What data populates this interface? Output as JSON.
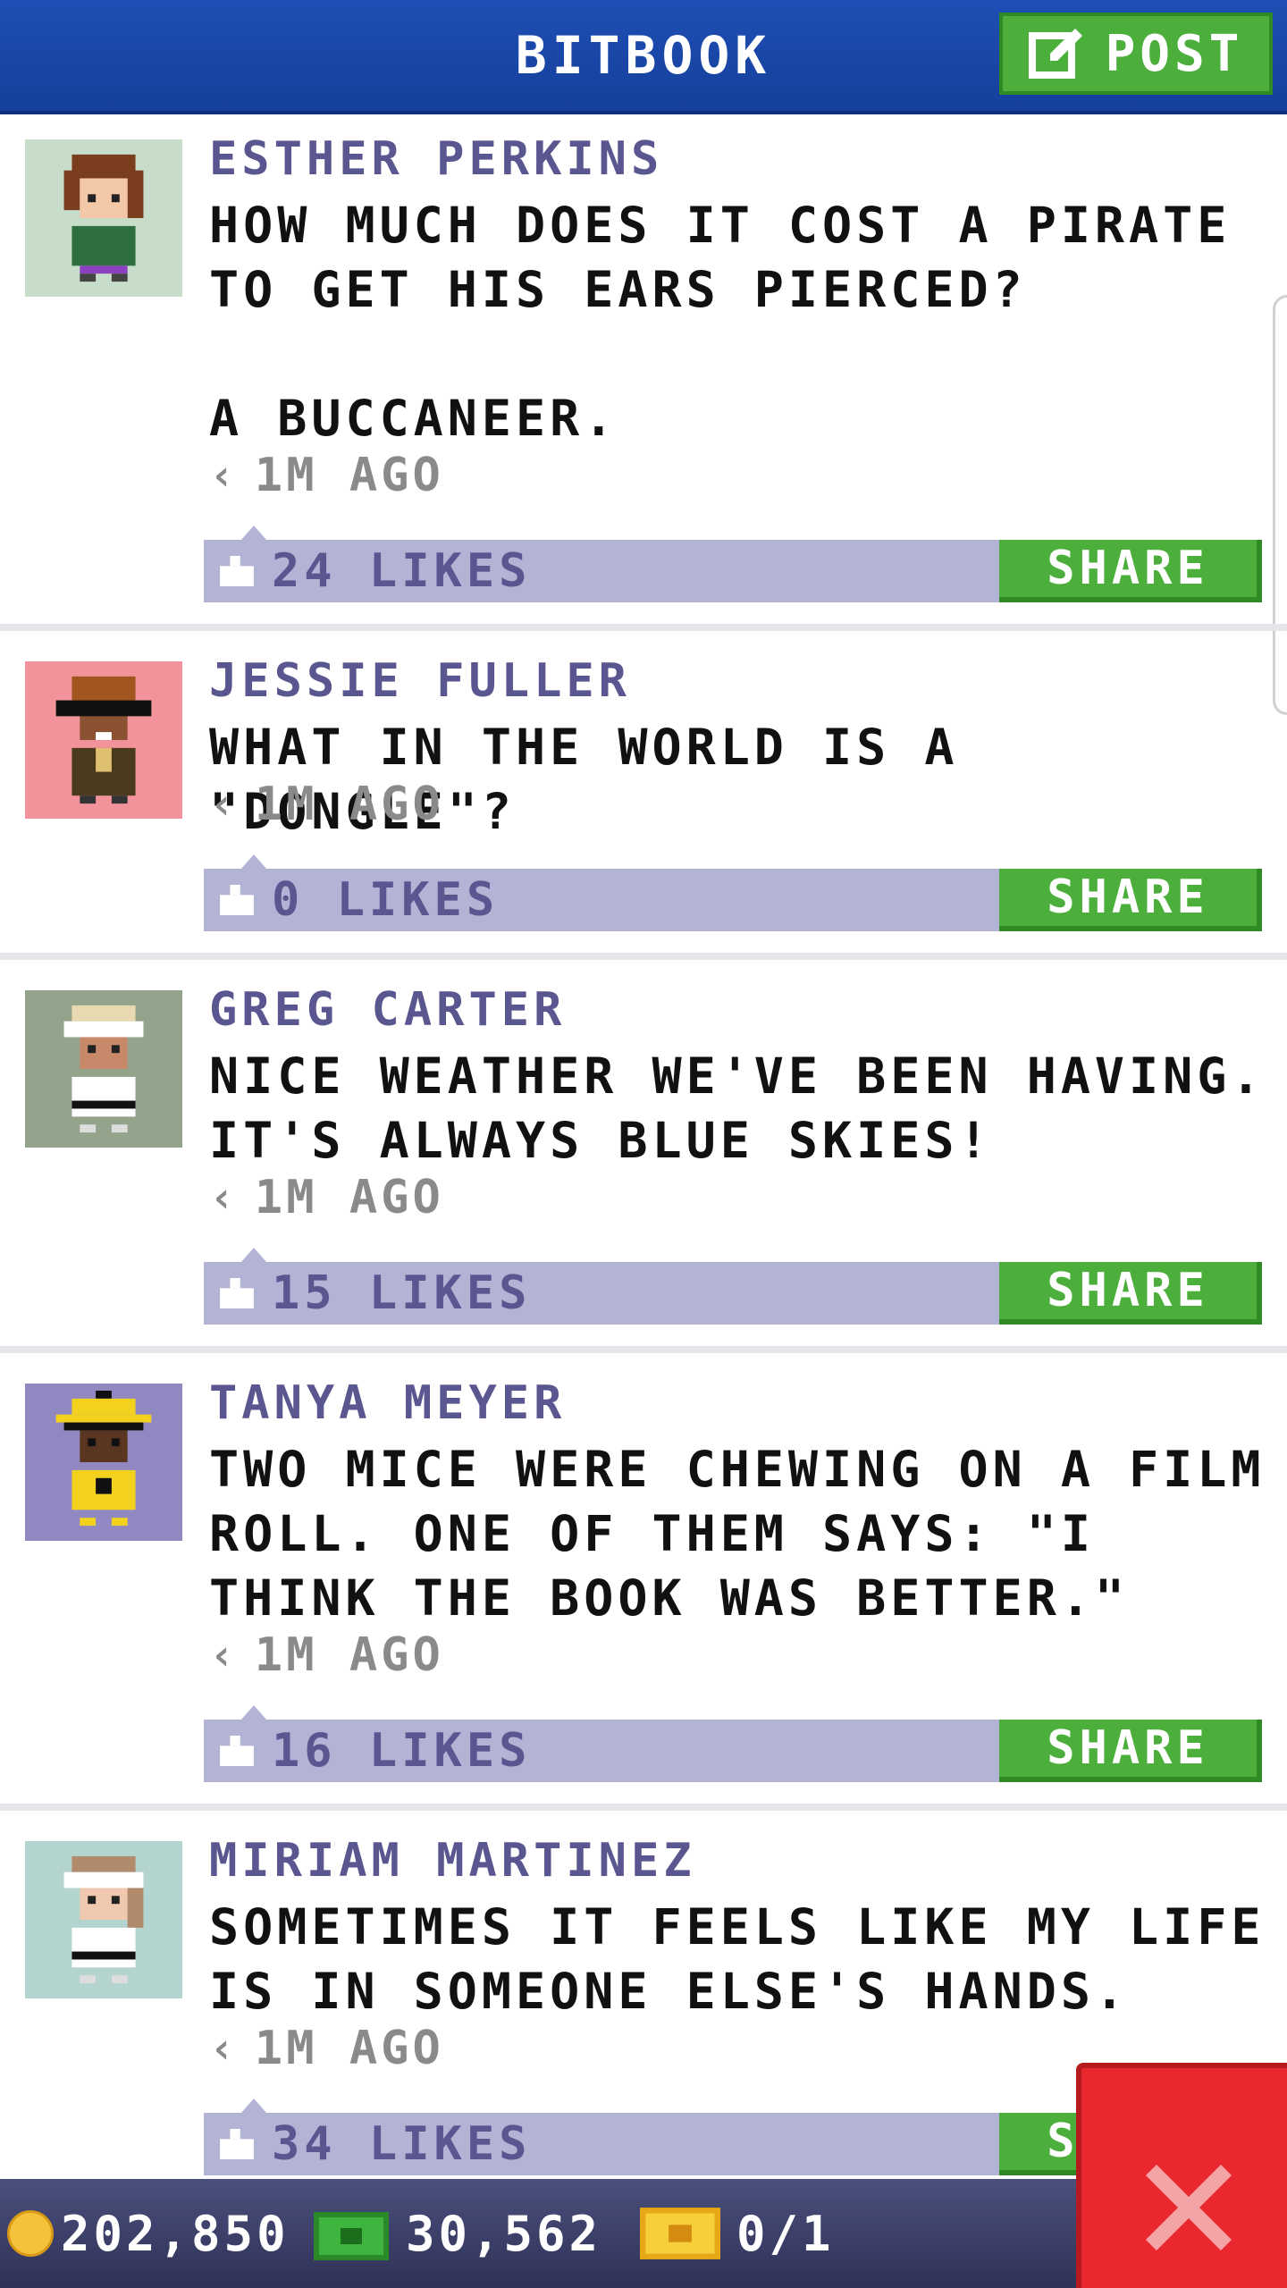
{
  "header": {
    "title": "BITBOOK",
    "post_label": "POST"
  },
  "posts": [
    {
      "author": "ESTHER PERKINS",
      "message": "HOW MUCH DOES IT COST A PIRATE TO GET HIS EARS PIERCED?\n\nA BUCCANEER.",
      "time": "1M AGO",
      "likes": "24 LIKES",
      "share_label": "SHARE",
      "avatar_bg": "#c7dcc9"
    },
    {
      "author": "JESSIE FULLER",
      "message": "WHAT IN THE WORLD IS A \"DONGLE\"?",
      "time": "1M AGO",
      "likes": "0 LIKES",
      "share_label": "SHARE",
      "avatar_bg": "#f2939b"
    },
    {
      "author": "GREG CARTER",
      "message": "NICE WEATHER WE'VE BEEN HAVING. IT'S ALWAYS BLUE SKIES!",
      "time": "1M AGO",
      "likes": "15 LIKES",
      "share_label": "SHARE",
      "avatar_bg": "#94a48c"
    },
    {
      "author": "TANYA MEYER",
      "message": "TWO MICE WERE CHEWING ON A FILM ROLL. ONE OF THEM SAYS: \"I THINK THE BOOK WAS BETTER.\"",
      "time": "1M AGO",
      "likes": "16 LIKES",
      "share_label": "SHARE",
      "avatar_bg": "#9188c2"
    },
    {
      "author": "MIRIAM MARTINEZ",
      "message": "SOMETIMES IT FEELS LIKE MY LIFE IS IN SOMEONE ELSE'S HANDS.",
      "time": "1M AGO",
      "likes": "34 LIKES",
      "share_label": "SHARE",
      "avatar_bg": "#b4d4cf"
    }
  ],
  "status": {
    "coins": "202,850",
    "cash": "30,562",
    "tickets": "0/1"
  },
  "colors": {
    "header": "#1f4fb5",
    "button_green": "#4caf3c",
    "like_bar": "#b3b3d6",
    "author": "#5a5690",
    "close_red": "#e8282e"
  },
  "icons": {
    "post": "edit-icon",
    "like": "thumbs-up-icon",
    "time": "chevron-left-icon",
    "coin": "coin-icon",
    "cash": "cash-icon",
    "ticket": "ticket-icon",
    "close": "close-icon"
  }
}
